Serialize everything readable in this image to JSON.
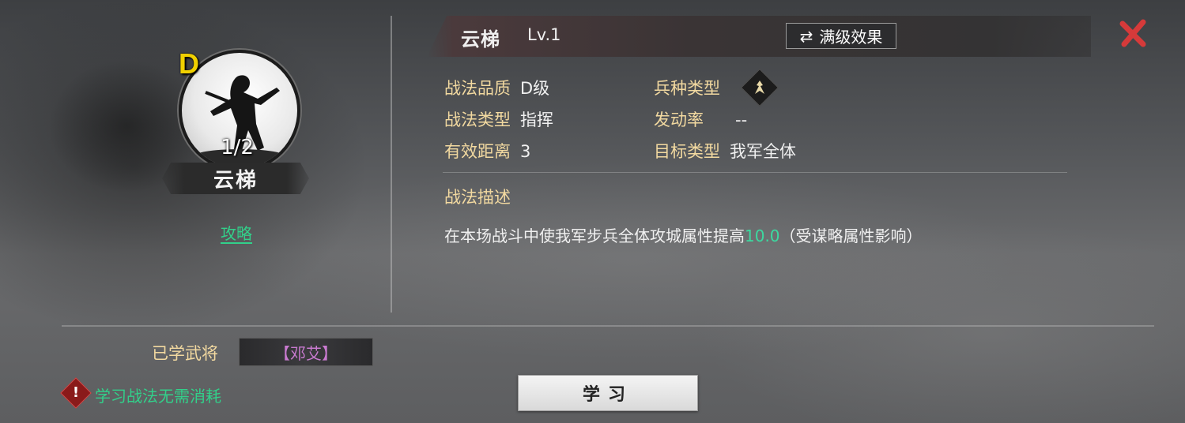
{
  "skill": {
    "grade_badge": "D",
    "count": "1/2",
    "name": "云梯",
    "strategy_link": "攻略"
  },
  "header": {
    "title": "云梯",
    "level": "Lv.1",
    "max_effect_label": "满级效果"
  },
  "attributes": {
    "quality_label": "战法品质",
    "quality_value": "D级",
    "type_label": "战法类型",
    "type_value": "指挥",
    "range_label": "有效距离",
    "range_value": "3",
    "troop_label": "兵种类型",
    "troop_icon": "infantry-icon",
    "rate_label": "发动率",
    "rate_value": "--",
    "target_label": "目标类型",
    "target_value": "我军全体"
  },
  "description": {
    "title": "战法描述",
    "text_before": "在本场战斗中使我军步兵全体攻城属性提高",
    "highlight": "10.0",
    "text_after": "（受谋略属性影响）"
  },
  "bottom": {
    "learned_label": "已学武将",
    "learned_general": "【邓艾】",
    "warning_text": "学习战法无需消耗",
    "learn_button": "学习"
  },
  "colors": {
    "label_gold": "#f2d9a0",
    "highlight_green": "#3cd9a0",
    "grade_yellow": "#f0d000",
    "general_purple": "#c97ad0",
    "close_red": "#d63a3a"
  }
}
